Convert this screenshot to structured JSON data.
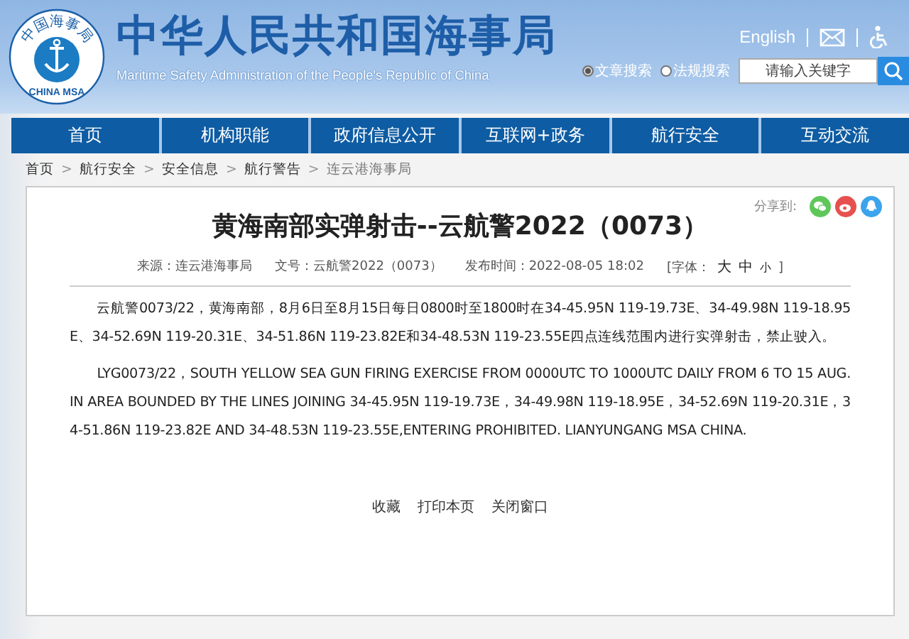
{
  "header": {
    "logo_top": "中国海事局",
    "logo_bottom": "CHINA MSA",
    "title": "中华人民共和国海事局",
    "subtitle": "Maritime Safety Administration of the People's Republic of China",
    "language_link": "English",
    "search_scopes": [
      {
        "label": "文章搜索",
        "selected": true
      },
      {
        "label": "法规搜索",
        "selected": false
      }
    ],
    "search": {
      "placeholder": "请输入关键字"
    }
  },
  "nav": [
    {
      "label": "首页"
    },
    {
      "label": "机构职能"
    },
    {
      "label": "政府信息公开"
    },
    {
      "label": "互联网+政务"
    },
    {
      "label": "航行安全"
    },
    {
      "label": "互动交流"
    }
  ],
  "breadcrumb": [
    {
      "label": "首页",
      "current": false
    },
    {
      "label": "航行安全",
      "current": false
    },
    {
      "label": "安全信息",
      "current": false
    },
    {
      "label": "航行警告",
      "current": false
    },
    {
      "label": "连云港海事局",
      "current": true
    }
  ],
  "separator": ">",
  "share": {
    "label": "分享到:"
  },
  "article": {
    "title": "黄海南部实弹射击--云航警2022（0073）",
    "meta": [
      {
        "kind": "text",
        "text": "来源：连云港海事局"
      },
      {
        "kind": "text",
        "text": "文号：云航警2022（0073）"
      },
      {
        "kind": "text",
        "text": "发布时间：2022-08-05 18:02"
      },
      {
        "kind": "fontsize",
        "text": "[字体：",
        "options": [
          "大",
          "中",
          "小"
        ],
        "end": "]"
      }
    ],
    "paragraphs": [
      "云航警0073/22，黄海南部，8月6日至8月15日每日0800时至1800时在34-45.95N 119-19.73E、34-49.98N 119-18.95E、34-52.69N 119-20.31E、34-51.86N 119-23.82E和34-48.53N 119-23.55E四点连线范围内进行实弹射击，禁止驶入。",
      "LYG0073/22，SOUTH YELLOW SEA GUN FIRING EXERCISE FROM 0000UTC TO 1000UTC DAILY FROM 6 TO 15 AUG. IN AREA BOUNDED BY THE LINES JOINING 34-45.95N 119-19.73E，34-49.98N 119-18.95E，34-52.69N 119-20.31E，34-51.86N 119-23.82E AND 34-48.53N 119-23.55E,ENTERING PROHIBITED. LIANYUNGANG MSA CHINA."
    ],
    "actions": [
      "收藏",
      "打印本页",
      "关闭窗口"
    ]
  }
}
